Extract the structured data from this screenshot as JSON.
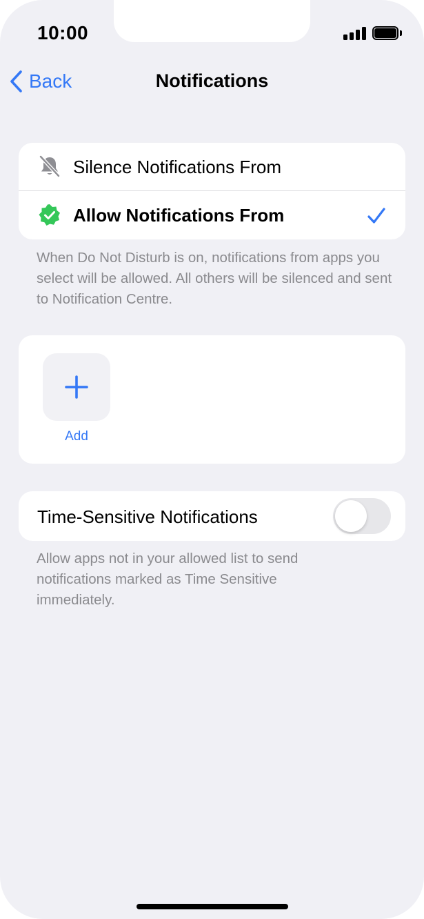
{
  "status_bar": {
    "time": "10:00",
    "icons": [
      "signal-icon",
      "battery-icon"
    ]
  },
  "nav": {
    "back_label": "Back",
    "title": "Notifications"
  },
  "mode_options": [
    {
      "label": "Silence Notifications From",
      "icon": "bell-slash-icon",
      "selected": false
    },
    {
      "label": "Allow Notifications From",
      "icon": "checkmark-seal-icon",
      "selected": true
    }
  ],
  "mode_footnote": "When Do Not Disturb is on, notifications from apps you select will be allowed. All others will be silenced and sent to Notification Centre.",
  "apps": {
    "add_label": "Add"
  },
  "time_sensitive": {
    "label": "Time-Sensitive Notifications",
    "enabled": false
  },
  "time_sensitive_footnote": "Allow apps not in your allowed list to send notifications marked as Time Sensitive immediately.",
  "colors": {
    "accent": "#3478f6",
    "allow_green": "#34c759",
    "background": "#f0f0f5"
  }
}
